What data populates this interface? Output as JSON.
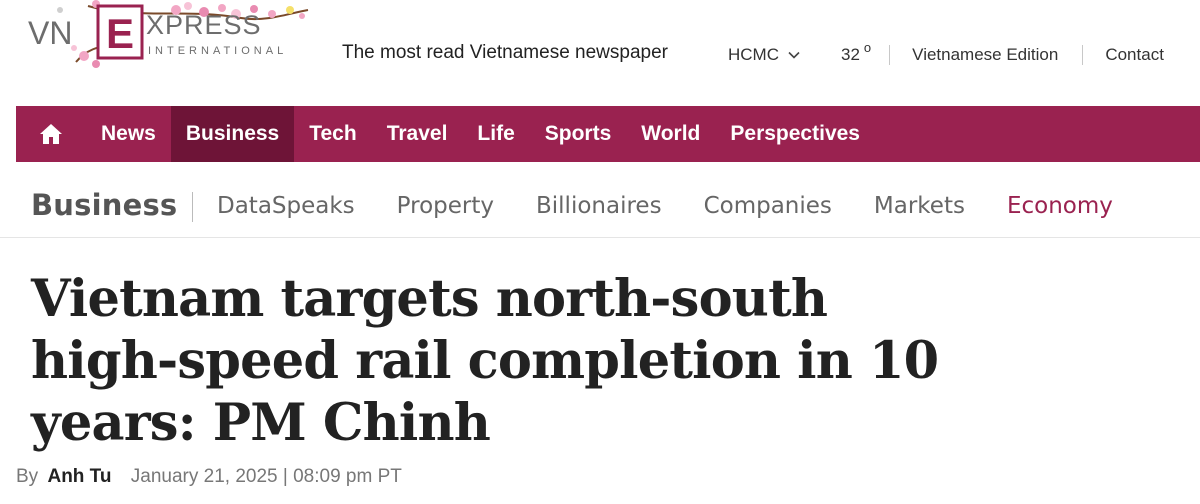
{
  "header": {
    "logo": {
      "brand_left": "VN",
      "brand_mark": "E",
      "brand_right": "XPRESS",
      "brand_sub": "INTERNATIONAL",
      "icon": "vnexpress-logo-with-blossoms"
    },
    "tagline": "The most read Vietnamese newspaper",
    "city": "HCMC",
    "temperature": "32",
    "temperature_unit": "o",
    "edition_link": "Vietnamese Edition",
    "contact_link": "Contact"
  },
  "main_nav": {
    "home_icon": "home-icon",
    "items": [
      {
        "label": "News",
        "active": false
      },
      {
        "label": "Business",
        "active": true
      },
      {
        "label": "Tech",
        "active": false
      },
      {
        "label": "Travel",
        "active": false
      },
      {
        "label": "Life",
        "active": false
      },
      {
        "label": "Sports",
        "active": false
      },
      {
        "label": "World",
        "active": false
      },
      {
        "label": "Perspectives",
        "active": false
      }
    ]
  },
  "sub_nav": {
    "section_title": "Business",
    "items": [
      {
        "label": "DataSpeaks",
        "active": false
      },
      {
        "label": "Property",
        "active": false
      },
      {
        "label": "Billionaires",
        "active": false
      },
      {
        "label": "Companies",
        "active": false
      },
      {
        "label": "Markets",
        "active": false
      },
      {
        "label": "Economy",
        "active": true
      }
    ]
  },
  "article": {
    "headline": "Vietnam targets north-south high-speed rail completion in 10 years: PM Chinh",
    "by_label": "By",
    "author": "Anh Tu",
    "date": "January 21, 2025 | 08:09 pm PT"
  },
  "colors": {
    "brand": "#9a2250",
    "brand_active": "#6e1437",
    "text_dark": "#222222",
    "text_muted": "#666666"
  }
}
